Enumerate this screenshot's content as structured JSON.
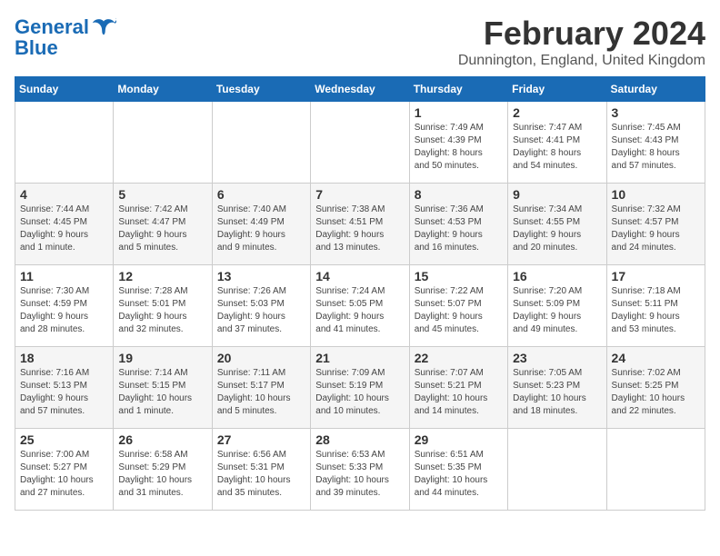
{
  "logo": {
    "text_general": "General",
    "text_blue": "Blue"
  },
  "header": {
    "month": "February 2024",
    "location": "Dunnington, England, United Kingdom"
  },
  "days_of_week": [
    "Sunday",
    "Monday",
    "Tuesday",
    "Wednesday",
    "Thursday",
    "Friday",
    "Saturday"
  ],
  "weeks": [
    [
      {
        "day": "",
        "info": ""
      },
      {
        "day": "",
        "info": ""
      },
      {
        "day": "",
        "info": ""
      },
      {
        "day": "",
        "info": ""
      },
      {
        "day": "1",
        "info": "Sunrise: 7:49 AM\nSunset: 4:39 PM\nDaylight: 8 hours\nand 50 minutes."
      },
      {
        "day": "2",
        "info": "Sunrise: 7:47 AM\nSunset: 4:41 PM\nDaylight: 8 hours\nand 54 minutes."
      },
      {
        "day": "3",
        "info": "Sunrise: 7:45 AM\nSunset: 4:43 PM\nDaylight: 8 hours\nand 57 minutes."
      }
    ],
    [
      {
        "day": "4",
        "info": "Sunrise: 7:44 AM\nSunset: 4:45 PM\nDaylight: 9 hours\nand 1 minute."
      },
      {
        "day": "5",
        "info": "Sunrise: 7:42 AM\nSunset: 4:47 PM\nDaylight: 9 hours\nand 5 minutes."
      },
      {
        "day": "6",
        "info": "Sunrise: 7:40 AM\nSunset: 4:49 PM\nDaylight: 9 hours\nand 9 minutes."
      },
      {
        "day": "7",
        "info": "Sunrise: 7:38 AM\nSunset: 4:51 PM\nDaylight: 9 hours\nand 13 minutes."
      },
      {
        "day": "8",
        "info": "Sunrise: 7:36 AM\nSunset: 4:53 PM\nDaylight: 9 hours\nand 16 minutes."
      },
      {
        "day": "9",
        "info": "Sunrise: 7:34 AM\nSunset: 4:55 PM\nDaylight: 9 hours\nand 20 minutes."
      },
      {
        "day": "10",
        "info": "Sunrise: 7:32 AM\nSunset: 4:57 PM\nDaylight: 9 hours\nand 24 minutes."
      }
    ],
    [
      {
        "day": "11",
        "info": "Sunrise: 7:30 AM\nSunset: 4:59 PM\nDaylight: 9 hours\nand 28 minutes."
      },
      {
        "day": "12",
        "info": "Sunrise: 7:28 AM\nSunset: 5:01 PM\nDaylight: 9 hours\nand 32 minutes."
      },
      {
        "day": "13",
        "info": "Sunrise: 7:26 AM\nSunset: 5:03 PM\nDaylight: 9 hours\nand 37 minutes."
      },
      {
        "day": "14",
        "info": "Sunrise: 7:24 AM\nSunset: 5:05 PM\nDaylight: 9 hours\nand 41 minutes."
      },
      {
        "day": "15",
        "info": "Sunrise: 7:22 AM\nSunset: 5:07 PM\nDaylight: 9 hours\nand 45 minutes."
      },
      {
        "day": "16",
        "info": "Sunrise: 7:20 AM\nSunset: 5:09 PM\nDaylight: 9 hours\nand 49 minutes."
      },
      {
        "day": "17",
        "info": "Sunrise: 7:18 AM\nSunset: 5:11 PM\nDaylight: 9 hours\nand 53 minutes."
      }
    ],
    [
      {
        "day": "18",
        "info": "Sunrise: 7:16 AM\nSunset: 5:13 PM\nDaylight: 9 hours\nand 57 minutes."
      },
      {
        "day": "19",
        "info": "Sunrise: 7:14 AM\nSunset: 5:15 PM\nDaylight: 10 hours\nand 1 minute."
      },
      {
        "day": "20",
        "info": "Sunrise: 7:11 AM\nSunset: 5:17 PM\nDaylight: 10 hours\nand 5 minutes."
      },
      {
        "day": "21",
        "info": "Sunrise: 7:09 AM\nSunset: 5:19 PM\nDaylight: 10 hours\nand 10 minutes."
      },
      {
        "day": "22",
        "info": "Sunrise: 7:07 AM\nSunset: 5:21 PM\nDaylight: 10 hours\nand 14 minutes."
      },
      {
        "day": "23",
        "info": "Sunrise: 7:05 AM\nSunset: 5:23 PM\nDaylight: 10 hours\nand 18 minutes."
      },
      {
        "day": "24",
        "info": "Sunrise: 7:02 AM\nSunset: 5:25 PM\nDaylight: 10 hours\nand 22 minutes."
      }
    ],
    [
      {
        "day": "25",
        "info": "Sunrise: 7:00 AM\nSunset: 5:27 PM\nDaylight: 10 hours\nand 27 minutes."
      },
      {
        "day": "26",
        "info": "Sunrise: 6:58 AM\nSunset: 5:29 PM\nDaylight: 10 hours\nand 31 minutes."
      },
      {
        "day": "27",
        "info": "Sunrise: 6:56 AM\nSunset: 5:31 PM\nDaylight: 10 hours\nand 35 minutes."
      },
      {
        "day": "28",
        "info": "Sunrise: 6:53 AM\nSunset: 5:33 PM\nDaylight: 10 hours\nand 39 minutes."
      },
      {
        "day": "29",
        "info": "Sunrise: 6:51 AM\nSunset: 5:35 PM\nDaylight: 10 hours\nand 44 minutes."
      },
      {
        "day": "",
        "info": ""
      },
      {
        "day": "",
        "info": ""
      }
    ]
  ]
}
